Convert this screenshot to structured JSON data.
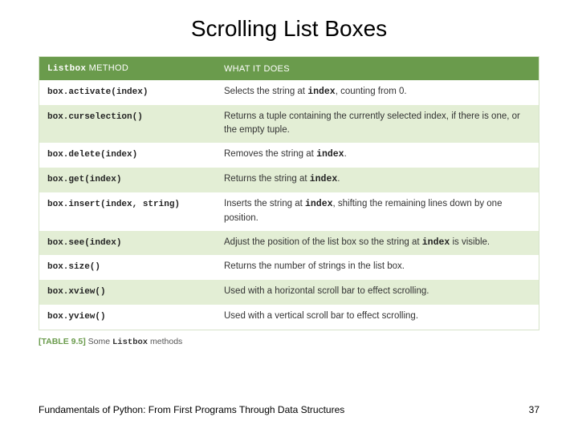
{
  "slide": {
    "title": "Scrolling List Boxes",
    "footer_text": "Fundamentals of Python: From First Programs Through Data Structures",
    "page_number": "37"
  },
  "table": {
    "header_col1_mono": "Listbox",
    "header_col1_rest": " METHOD",
    "header_col2": "WHAT IT DOES",
    "rows": [
      {
        "method": "box.activate(index)",
        "desc_pre": "Selects the string at ",
        "desc_code": "index",
        "desc_post": ", counting from 0."
      },
      {
        "method": "box.curselection()",
        "desc_pre": "Returns a tuple containing the currently selected index, if there is one, or the empty tuple.",
        "desc_code": "",
        "desc_post": ""
      },
      {
        "method": "box.delete(index)",
        "desc_pre": "Removes the string at ",
        "desc_code": "index",
        "desc_post": "."
      },
      {
        "method": "box.get(index)",
        "desc_pre": "Returns the string at ",
        "desc_code": "index",
        "desc_post": "."
      },
      {
        "method": "box.insert(index, string)",
        "desc_pre": "Inserts the string at ",
        "desc_code": "index",
        "desc_post": ", shifting the remaining lines down by one position."
      },
      {
        "method": "box.see(index)",
        "desc_pre": "Adjust the position of the list box so the string at ",
        "desc_code": "index",
        "desc_post": " is visible."
      },
      {
        "method": "box.size()",
        "desc_pre": "Returns the number of strings in the list box.",
        "desc_code": "",
        "desc_post": ""
      },
      {
        "method": "box.xview()",
        "desc_pre": "Used with a horizontal scroll bar to effect scrolling.",
        "desc_code": "",
        "desc_post": ""
      },
      {
        "method": "box.yview()",
        "desc_pre": "Used with a vertical scroll bar to effect scrolling.",
        "desc_code": "",
        "desc_post": ""
      }
    ]
  },
  "caption": {
    "tag": "[TABLE 9.5]",
    "text_pre": " Some ",
    "mono": "Listbox",
    "text_post": " methods"
  }
}
